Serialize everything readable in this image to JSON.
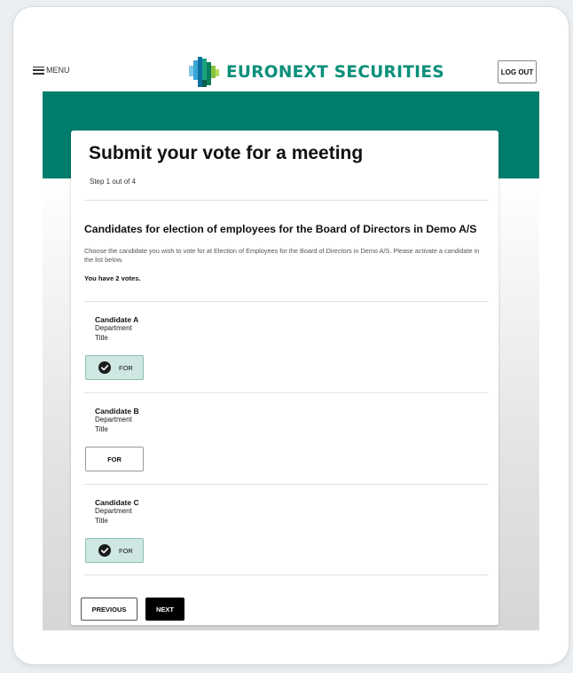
{
  "header": {
    "menu_label": "MENU",
    "logo_text": "EURONEXT SECURITIES",
    "logout_label": "LOG OUT"
  },
  "card": {
    "title": "Submit your vote for a meeting",
    "step": "Step 1 out of 4",
    "section_title": "Candidates for election of employees for the Board of Directors in Demo A/S",
    "description": "Choose the candidate you wish to vote for at Election of Employees for the Board of Directors in Demo A/S. Please activate a candidate in the list below.",
    "votes_text": "You have 2 votes."
  },
  "candidates": [
    {
      "name": "Candidate A",
      "department": "Department",
      "title": "Title",
      "vote_label": "FOR",
      "selected": true
    },
    {
      "name": "Candidate B",
      "department": "Department",
      "title": "Title",
      "vote_label": "FOR",
      "selected": false
    },
    {
      "name": "Candidate C",
      "department": "Department",
      "title": "Title",
      "vote_label": "FOR",
      "selected": true
    }
  ],
  "footer": {
    "previous_label": "PREVIOUS",
    "next_label": "NEXT"
  },
  "colors": {
    "brand_green": "#007d6c",
    "logo_text": "#0b8f7a",
    "selected_bg": "#cfe7e2"
  },
  "icons": {
    "menu": "hamburger-icon",
    "logo": "euronext-logo-icon",
    "selected": "check-circle-icon"
  }
}
